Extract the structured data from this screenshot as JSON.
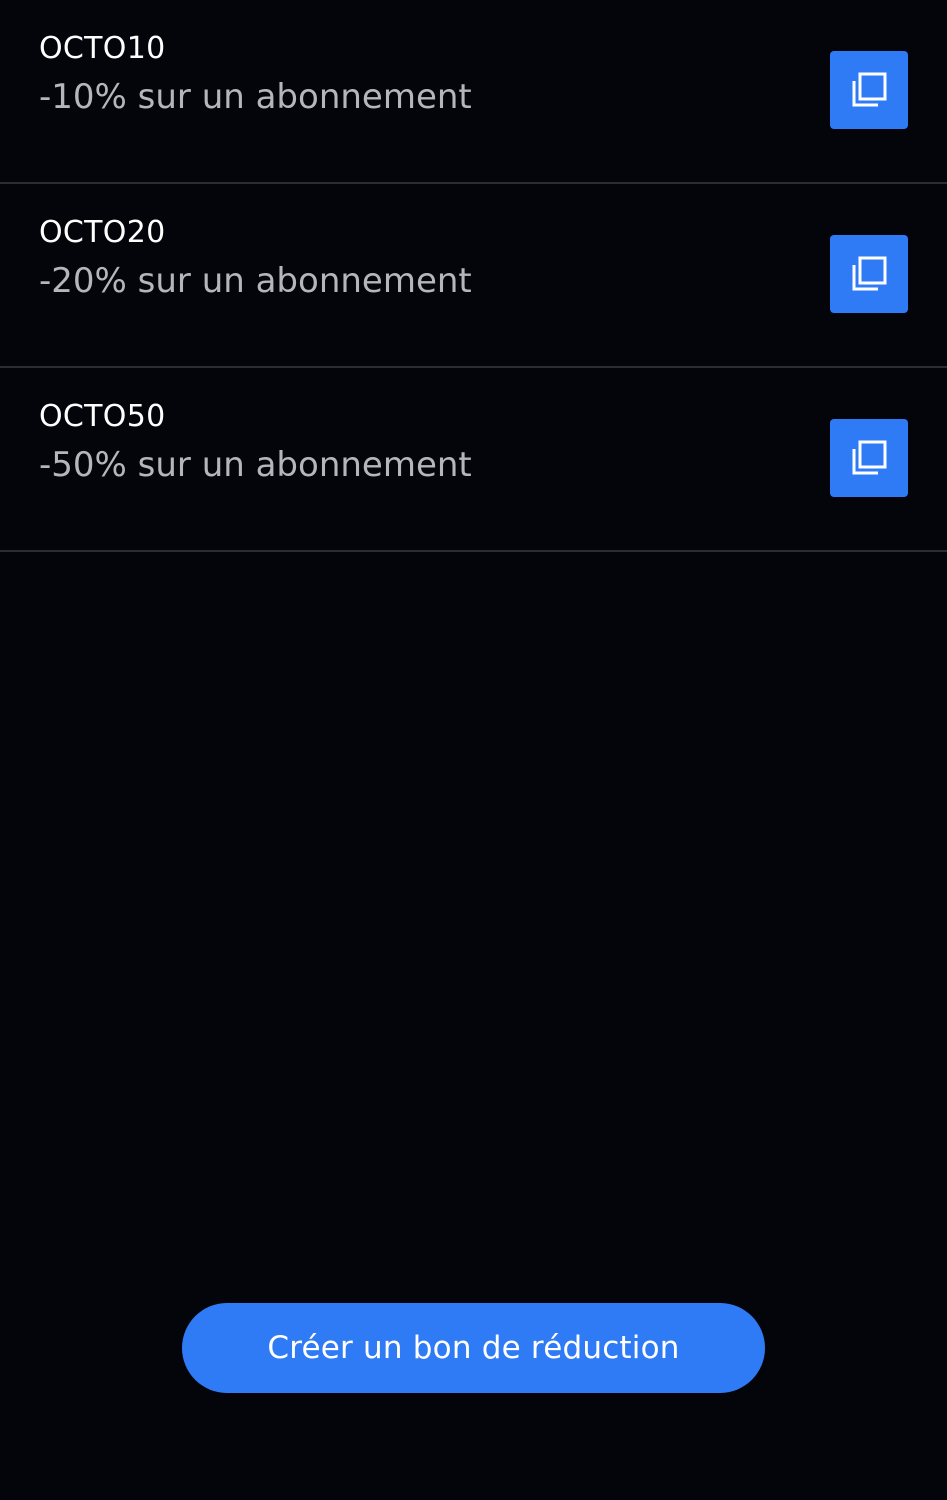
{
  "coupons": [
    {
      "code": "OCTO10",
      "description": "-10% sur un abonnement",
      "action_icon": "copy-icon"
    },
    {
      "code": "OCTO20",
      "description": "-20% sur un abonnement",
      "action_icon": "copy-icon"
    },
    {
      "code": "OCTO50",
      "description": "-50% sur un abonnement",
      "action_icon": "copy-icon"
    }
  ],
  "create_button": {
    "label": "Créer un bon de réduction"
  },
  "colors": {
    "background": "#04050a",
    "accent": "#2f7bf6",
    "divider": "#2b2d33",
    "code_text": "#ffffff",
    "description_text": "#b4b6bc"
  }
}
